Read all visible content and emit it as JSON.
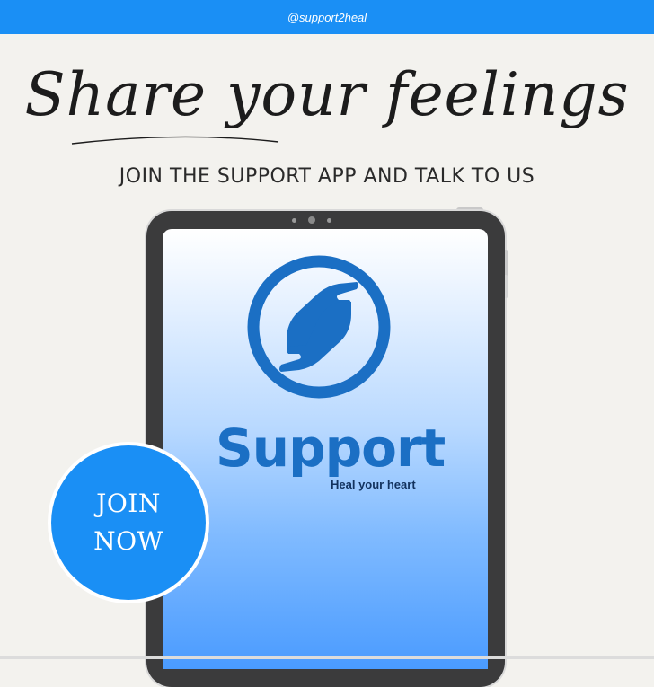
{
  "banner": {
    "handle": "@support2heal",
    "color": "#1a8ff5"
  },
  "headline": {
    "text": "Share your feelings"
  },
  "subtitle": "JOIN THE SUPPORT APP AND TALK TO US",
  "app": {
    "icon": "helping-hands-icon",
    "name": "Support",
    "tagline": "Heal your heart",
    "brand_color": "#1b6fc4"
  },
  "cta": {
    "line1": "JOIN",
    "line2": "NOW",
    "color": "#1a8ff5"
  }
}
